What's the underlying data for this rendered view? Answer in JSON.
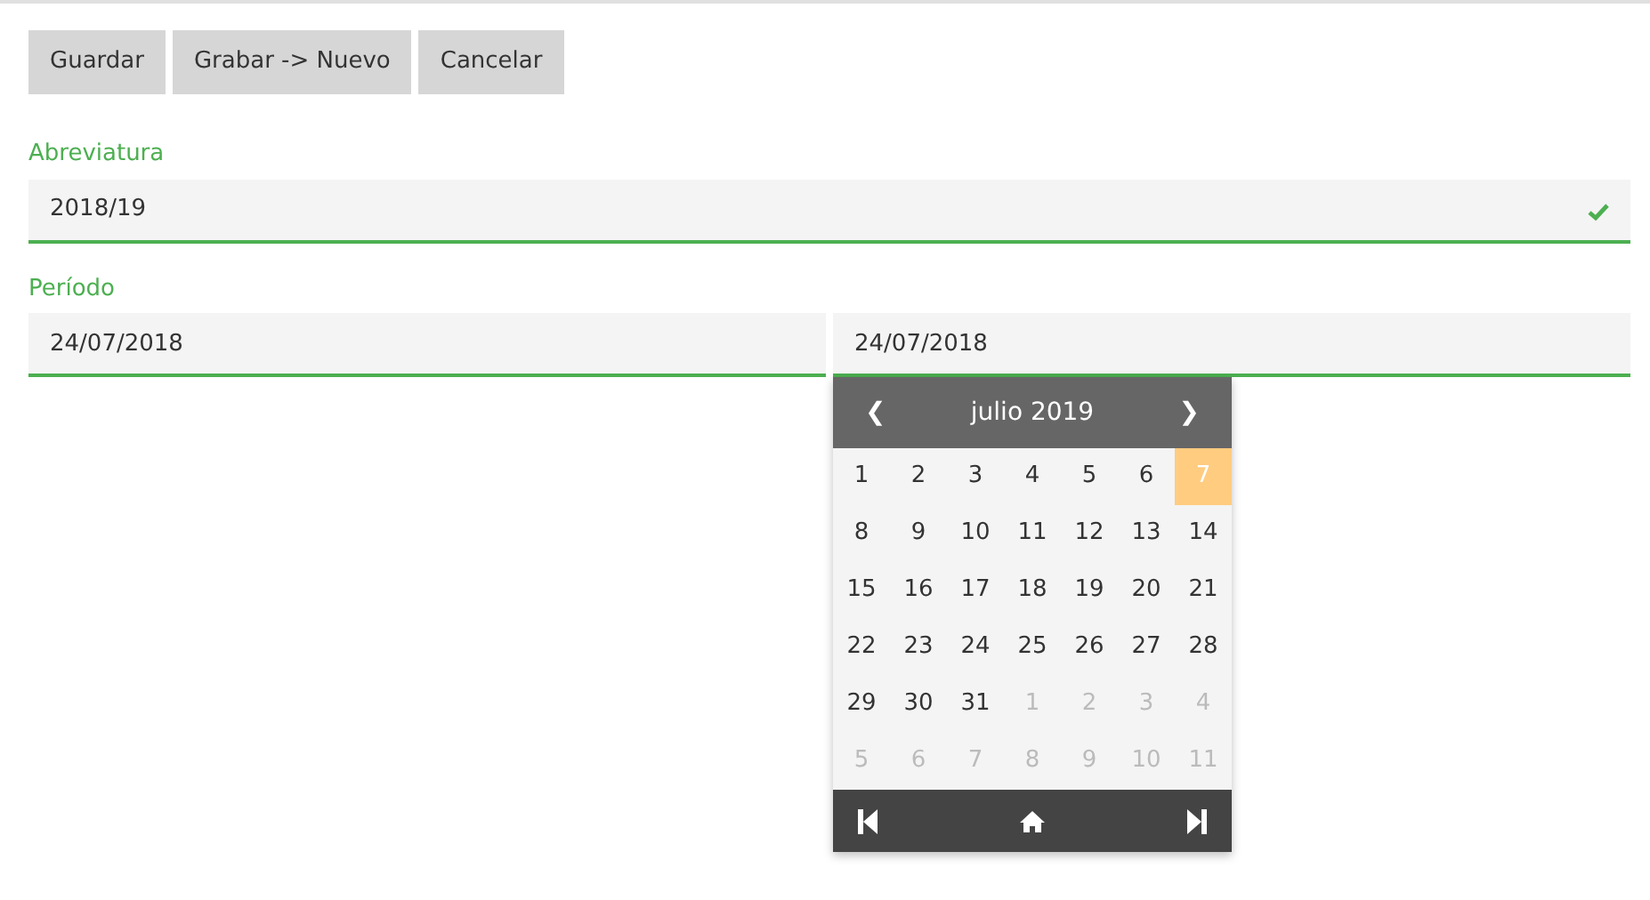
{
  "buttons": [
    "Guardar",
    "Grabar -> Nuevo",
    "Cancelar"
  ],
  "fields": [
    {
      "label": "Abreviatura",
      "values": [
        "2018/19"
      ],
      "valid": true
    },
    {
      "label": "Período",
      "values": [
        "24/07/2018",
        "24/07/2018"
      ],
      "valid": false
    }
  ],
  "calendar": {
    "prev": "❮",
    "title": "julio 2019",
    "next": "❯",
    "weeks": [
      [
        {
          "day": "1",
          "muted": false,
          "selected": false
        },
        {
          "day": "2",
          "muted": false,
          "selected": false
        },
        {
          "day": "3",
          "muted": false,
          "selected": false
        },
        {
          "day": "4",
          "muted": false,
          "selected": false
        },
        {
          "day": "5",
          "muted": false,
          "selected": false
        },
        {
          "day": "6",
          "muted": false,
          "selected": false
        },
        {
          "day": "7",
          "muted": false,
          "selected": true
        }
      ],
      [
        {
          "day": "8",
          "muted": false,
          "selected": false
        },
        {
          "day": "9",
          "muted": false,
          "selected": false
        },
        {
          "day": "10",
          "muted": false,
          "selected": false
        },
        {
          "day": "11",
          "muted": false,
          "selected": false
        },
        {
          "day": "12",
          "muted": false,
          "selected": false
        },
        {
          "day": "13",
          "muted": false,
          "selected": false
        },
        {
          "day": "14",
          "muted": false,
          "selected": false
        }
      ],
      [
        {
          "day": "15",
          "muted": false,
          "selected": false
        },
        {
          "day": "16",
          "muted": false,
          "selected": false
        },
        {
          "day": "17",
          "muted": false,
          "selected": false
        },
        {
          "day": "18",
          "muted": false,
          "selected": false
        },
        {
          "day": "19",
          "muted": false,
          "selected": false
        },
        {
          "day": "20",
          "muted": false,
          "selected": false
        },
        {
          "day": "21",
          "muted": false,
          "selected": false
        }
      ],
      [
        {
          "day": "22",
          "muted": false,
          "selected": false
        },
        {
          "day": "23",
          "muted": false,
          "selected": false
        },
        {
          "day": "24",
          "muted": false,
          "selected": false
        },
        {
          "day": "25",
          "muted": false,
          "selected": false
        },
        {
          "day": "26",
          "muted": false,
          "selected": false
        },
        {
          "day": "27",
          "muted": false,
          "selected": false
        },
        {
          "day": "28",
          "muted": false,
          "selected": false
        }
      ],
      [
        {
          "day": "29",
          "muted": false,
          "selected": false
        },
        {
          "day": "30",
          "muted": false,
          "selected": false
        },
        {
          "day": "31",
          "muted": false,
          "selected": false
        },
        {
          "day": "1",
          "muted": true,
          "selected": false
        },
        {
          "day": "2",
          "muted": true,
          "selected": false
        },
        {
          "day": "3",
          "muted": true,
          "selected": false
        },
        {
          "day": "4",
          "muted": true,
          "selected": false
        }
      ],
      [
        {
          "day": "5",
          "muted": true,
          "selected": false
        },
        {
          "day": "6",
          "muted": true,
          "selected": false
        },
        {
          "day": "7",
          "muted": true,
          "selected": false
        },
        {
          "day": "8",
          "muted": true,
          "selected": false
        },
        {
          "day": "9",
          "muted": true,
          "selected": false
        },
        {
          "day": "10",
          "muted": true,
          "selected": false
        },
        {
          "day": "11",
          "muted": true,
          "selected": false
        }
      ]
    ]
  }
}
